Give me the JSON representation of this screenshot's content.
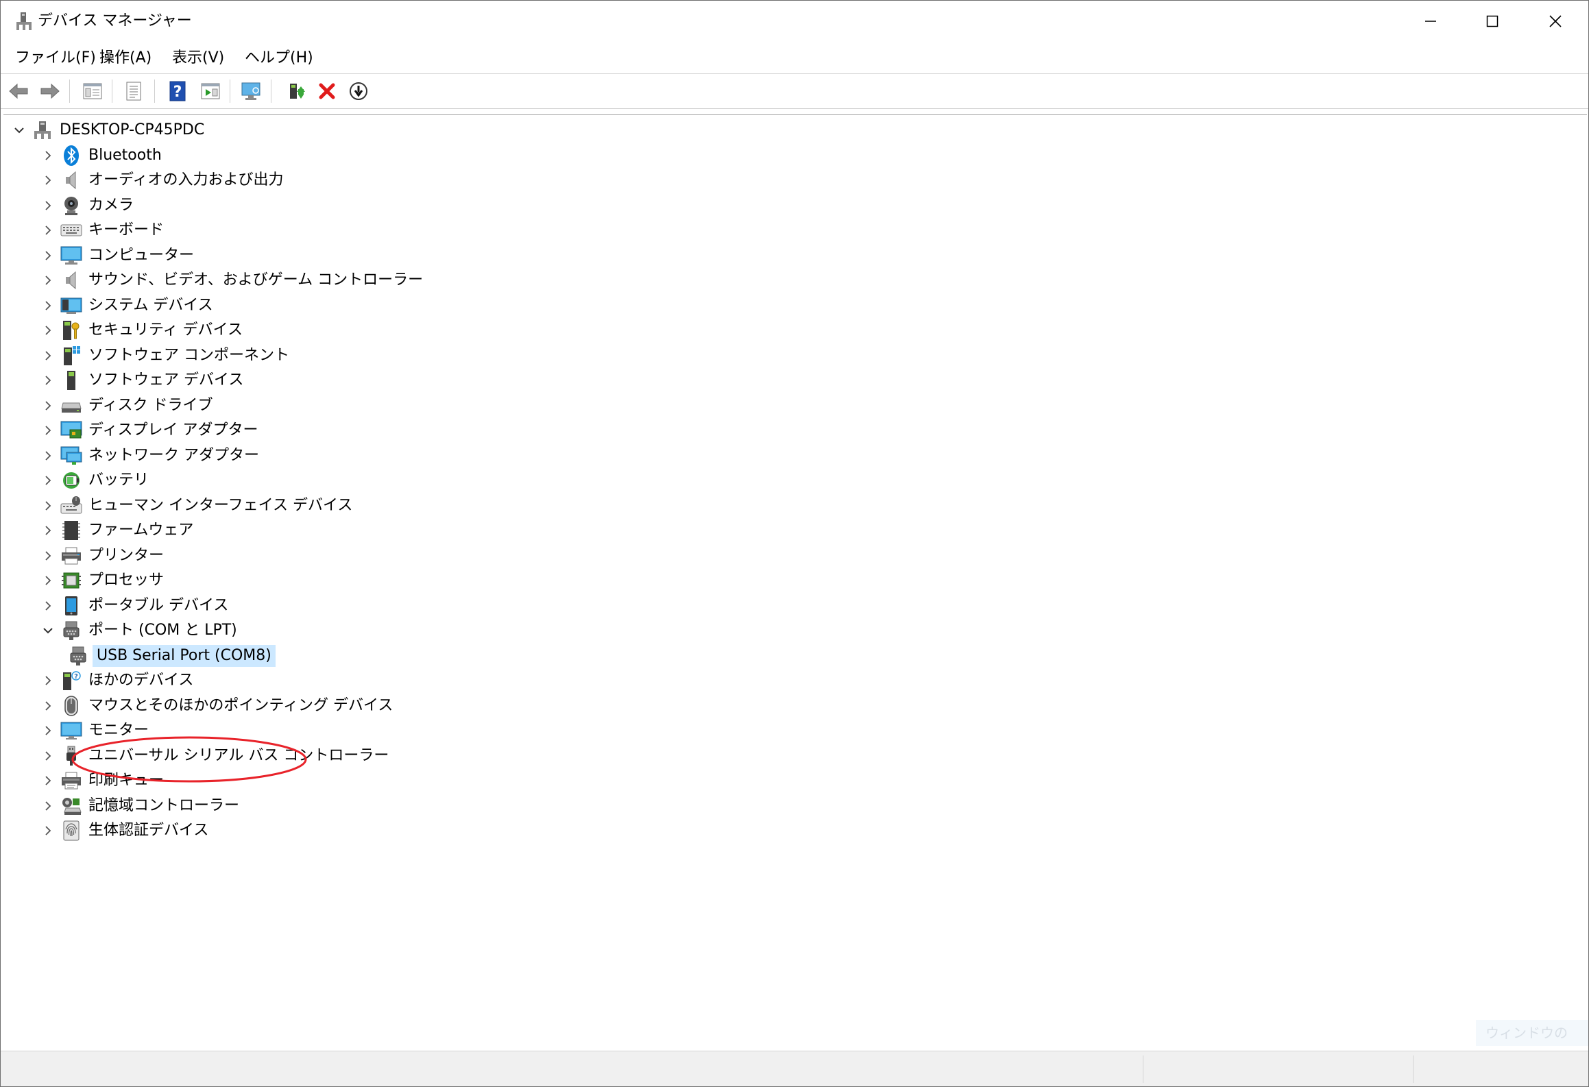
{
  "window": {
    "title": "デバイス マネージャー"
  },
  "menu": [
    "ファイル(F)",
    "操作(A)",
    "表示(V)",
    "ヘルプ(H)"
  ],
  "toolbar": [
    "back-icon",
    "forward-icon",
    "show-hide-console-tree-icon",
    "properties-icon",
    "help-icon",
    "run-action-icon",
    "scan-hardware-icon",
    "update-driver-icon",
    "uninstall-device-icon",
    "disable-device-icon"
  ],
  "tree": {
    "root": "DESKTOP-CP45PDC",
    "categories": [
      {
        "label": "Bluetooth",
        "icon": "bluetooth-icon"
      },
      {
        "label": "オーディオの入力および出力",
        "icon": "speaker-icon"
      },
      {
        "label": "カメラ",
        "icon": "camera-icon"
      },
      {
        "label": "キーボード",
        "icon": "keyboard-icon"
      },
      {
        "label": "コンピューター",
        "icon": "computer-icon"
      },
      {
        "label": "サウンド、ビデオ、およびゲーム コントローラー",
        "icon": "speaker-icon"
      },
      {
        "label": "システム デバイス",
        "icon": "system-device-icon"
      },
      {
        "label": "セキュリティ デバイス",
        "icon": "security-device-icon"
      },
      {
        "label": "ソフトウェア コンポーネント",
        "icon": "software-component-icon"
      },
      {
        "label": "ソフトウェア デバイス",
        "icon": "software-device-icon"
      },
      {
        "label": "ディスク ドライブ",
        "icon": "disk-drive-icon"
      },
      {
        "label": "ディスプレイ アダプター",
        "icon": "display-adapter-icon"
      },
      {
        "label": "ネットワーク アダプター",
        "icon": "network-adapter-icon"
      },
      {
        "label": "バッテリ",
        "icon": "battery-icon"
      },
      {
        "label": "ヒューマン インターフェイス デバイス",
        "icon": "hid-icon"
      },
      {
        "label": "ファームウェア",
        "icon": "firmware-icon"
      },
      {
        "label": "プリンター",
        "icon": "printer-icon"
      },
      {
        "label": "プロセッサ",
        "icon": "processor-icon"
      },
      {
        "label": "ポータブル デバイス",
        "icon": "portable-device-icon"
      },
      {
        "label": "ポート (COM と LPT)",
        "icon": "port-icon",
        "expanded": true
      },
      {
        "label": "USB Serial Port (COM8)",
        "icon": "port-icon",
        "child": true,
        "selected": true
      },
      {
        "label": "ほかのデバイス",
        "icon": "other-device-icon"
      },
      {
        "label": "マウスとそのほかのポインティング デバイス",
        "icon": "mouse-icon"
      },
      {
        "label": "モニター",
        "icon": "monitor-icon"
      },
      {
        "label": "ユニバーサル シリアル バス コントローラー",
        "icon": "usb-icon"
      },
      {
        "label": "印刷キュー",
        "icon": "print-queue-icon"
      },
      {
        "label": "記憶域コントローラー",
        "icon": "storage-controller-icon"
      },
      {
        "label": "生体認証デバイス",
        "icon": "biometric-icon"
      }
    ]
  },
  "overlay": {
    "watermark": "ウィンドウの"
  },
  "colors": {
    "selection": "#cce8ff",
    "annotation": "#e8232a",
    "accent": "#0a7fd8"
  }
}
